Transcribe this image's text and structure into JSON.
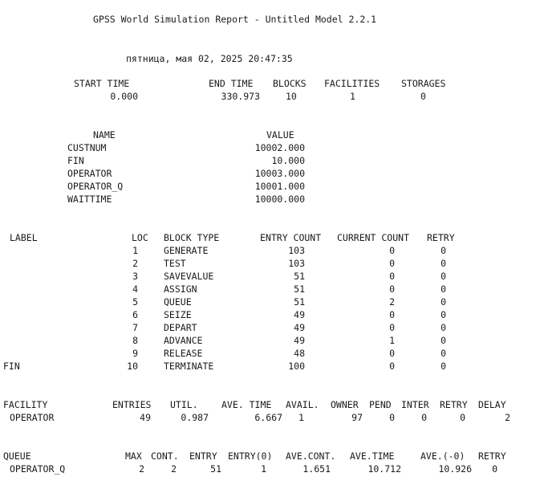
{
  "report": {
    "title": "GPSS World Simulation Report - Untitled Model 2.2.1",
    "datetime": "пятница, мая 02, 2025 20:47:35"
  },
  "summary": {
    "headers": [
      "START TIME",
      "END TIME",
      "BLOCKS",
      "FACILITIES",
      "STORAGES"
    ],
    "values": [
      "0.000",
      "330.973",
      "10",
      "1",
      "0"
    ]
  },
  "names": {
    "headers": [
      "NAME",
      "VALUE"
    ],
    "rows": [
      [
        "CUSTNUM",
        "10002.000"
      ],
      [
        "FIN",
        "10.000"
      ],
      [
        "OPERATOR",
        "10003.000"
      ],
      [
        "OPERATOR_Q",
        "10001.000"
      ],
      [
        "WAITTIME",
        "10000.000"
      ]
    ]
  },
  "blocks": {
    "headers": [
      "LABEL",
      "LOC",
      "BLOCK TYPE",
      "ENTRY COUNT",
      "CURRENT COUNT",
      "RETRY"
    ],
    "rows": [
      [
        "",
        "1",
        "GENERATE",
        "103",
        "0",
        "0"
      ],
      [
        "",
        "2",
        "TEST",
        "103",
        "0",
        "0"
      ],
      [
        "",
        "3",
        "SAVEVALUE",
        "51",
        "0",
        "0"
      ],
      [
        "",
        "4",
        "ASSIGN",
        "51",
        "0",
        "0"
      ],
      [
        "",
        "5",
        "QUEUE",
        "51",
        "2",
        "0"
      ],
      [
        "",
        "6",
        "SEIZE",
        "49",
        "0",
        "0"
      ],
      [
        "",
        "7",
        "DEPART",
        "49",
        "0",
        "0"
      ],
      [
        "",
        "8",
        "ADVANCE",
        "49",
        "1",
        "0"
      ],
      [
        "",
        "9",
        "RELEASE",
        "48",
        "0",
        "0"
      ],
      [
        "FIN",
        "10",
        "TERMINATE",
        "100",
        "0",
        "0"
      ]
    ]
  },
  "facility": {
    "headers": [
      "FACILITY",
      "ENTRIES",
      "UTIL.",
      "AVE. TIME",
      "AVAIL.",
      "OWNER",
      "PEND",
      "INTER",
      "RETRY",
      "DELAY"
    ],
    "row": [
      "OPERATOR",
      "49",
      "0.987",
      "6.667",
      "1",
      "97",
      "0",
      "0",
      "0",
      "2"
    ]
  },
  "queue": {
    "headers": [
      "QUEUE",
      "MAX",
      "CONT.",
      "ENTRY",
      "ENTRY(0)",
      "AVE.CONT.",
      "AVE.TIME",
      "AVE.(-0)",
      "RETRY"
    ],
    "row": [
      "OPERATOR_Q",
      "2",
      "2",
      "51",
      "1",
      "1.651",
      "10.712",
      "10.926",
      "0"
    ]
  }
}
